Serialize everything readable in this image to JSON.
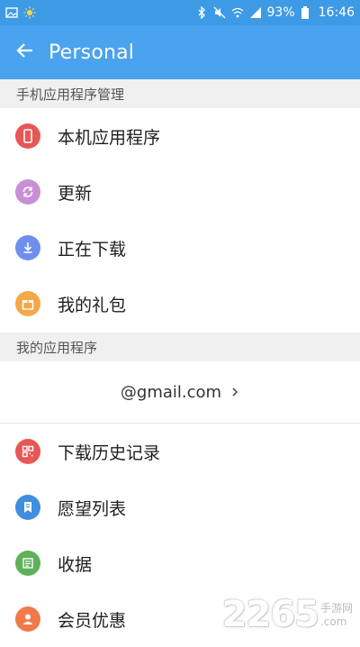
{
  "status_bar": {
    "battery": "93%",
    "time": "16:46",
    "left_icons": [
      "image-icon",
      "sun-icon"
    ],
    "right_icons": [
      "bluetooth-icon",
      "mute-icon",
      "wifi-icon",
      "signal-icon",
      "battery-icon"
    ]
  },
  "app_bar": {
    "title": "Personal",
    "back_icon": "arrow-left-icon"
  },
  "sections": [
    {
      "header": "手机应用程序管理",
      "items": [
        {
          "label": "本机应用程序",
          "icon": "phone-icon",
          "color": "#e85757"
        },
        {
          "label": "更新",
          "icon": "refresh-icon",
          "color": "#c98fd6"
        },
        {
          "label": "正在下载",
          "icon": "download-icon",
          "color": "#6e8ff0"
        },
        {
          "label": "我的礼包",
          "icon": "gift-icon",
          "color": "#f2a94a"
        }
      ]
    },
    {
      "header": "我的应用程序",
      "account": "@gmail.com",
      "items": [
        {
          "label": "下载历史记录",
          "icon": "qr-icon",
          "color": "#e85757"
        },
        {
          "label": "愿望列表",
          "icon": "bookmark-icon",
          "color": "#3f8ee0"
        },
        {
          "label": "收据",
          "icon": "receipt-icon",
          "color": "#5fb05a"
        },
        {
          "label": "会员优惠",
          "icon": "person-icon",
          "color": "#f27a4a"
        }
      ]
    }
  ],
  "watermark": {
    "number": "2265",
    "suffix": "手游网",
    "domain": ".com"
  }
}
